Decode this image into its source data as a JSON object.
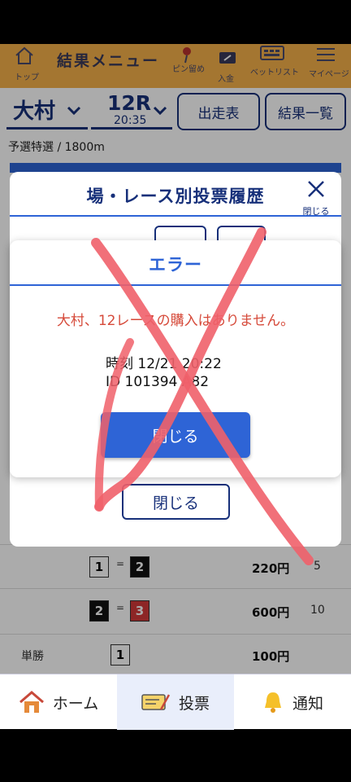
{
  "topnav": {
    "home_label": "トップ",
    "title": "結果メニュー",
    "pin_label": "ピン留め",
    "deposit_label": "入金",
    "betlist_label": "ベットリスト",
    "mypage_label": "マイページ"
  },
  "header": {
    "venue": "大村",
    "race": "12R",
    "race_time": "20:35",
    "entries_button": "出走表",
    "results_button": "結果一覧",
    "race_info": "予選特選 / 1800m"
  },
  "results": {
    "rows": [
      {
        "kind": "",
        "combo": [
          "1",
          "2"
        ],
        "payout": "220円",
        "popularity": "5"
      },
      {
        "kind": "",
        "combo": [
          "2",
          "3"
        ],
        "payout": "600円",
        "popularity": "10"
      },
      {
        "kind": "単勝",
        "combo": [
          "1"
        ],
        "payout": "100円",
        "popularity": ""
      }
    ],
    "separator": "="
  },
  "history_modal": {
    "title": "場・レース別投票履歴",
    "close_label": "閉じる",
    "close_button": "閉じる"
  },
  "error_modal": {
    "title": "エラー",
    "message": "大村、12レースの購入はありません。",
    "time_line": "時刻 12/21 20:22",
    "id_line": "ID  101394  A82",
    "close_button": "閉じる"
  },
  "tabbar": {
    "home": "ホーム",
    "vote": "投票",
    "notify": "通知"
  },
  "colors": {
    "navy": "#17307a",
    "accent_blue": "#2e64d6",
    "error_red": "#d64a3a",
    "nav_orange": "#f5b14a",
    "scribble": "#f0606a"
  }
}
